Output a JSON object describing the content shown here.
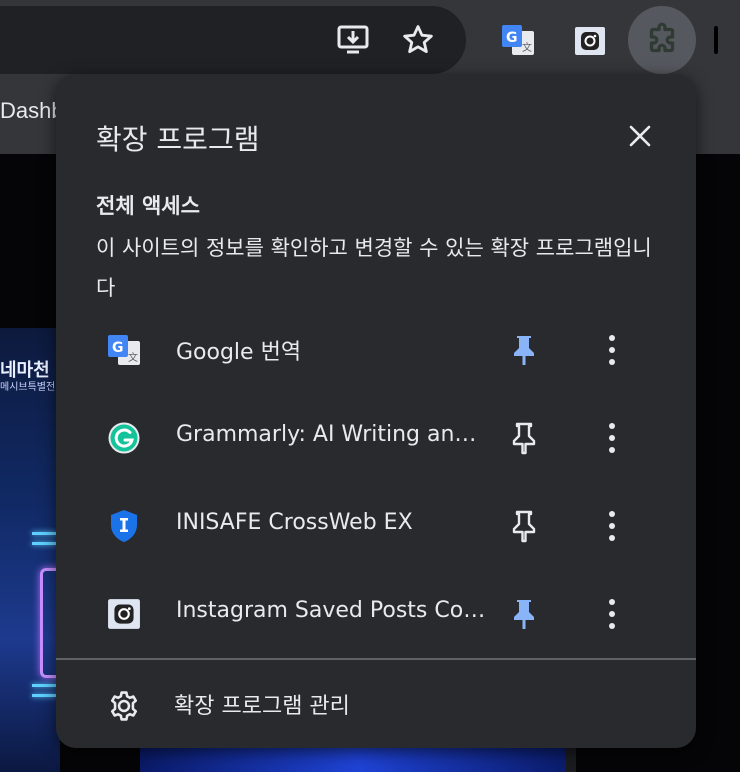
{
  "browser": {
    "tab_title": "Dashb",
    "toolbar_icons": [
      "install-app-icon",
      "bookmark-star-icon",
      "google-translate-icon",
      "instagram-saver-icon",
      "extensions-puzzle-icon"
    ]
  },
  "background_page": {
    "poster_title": "네마천",
    "poster_subtitle": "메시브특별전"
  },
  "popup": {
    "title": "확장 프로그램",
    "close_icon": "close-icon",
    "section": {
      "heading": "전체 액세스",
      "description": "이 사이트의 정보를 확인하고 변경할 수 있는 확장 프로그램입니다"
    },
    "extensions": [
      {
        "name": "Google 번역",
        "icon": "google-translate-icon",
        "pinned": true
      },
      {
        "name": "Grammarly: AI Writing and Grammar Checker App",
        "icon": "grammarly-icon",
        "pinned": false
      },
      {
        "name": "INISAFE CrossWeb EX",
        "icon": "inisafe-shield-icon",
        "pinned": false
      },
      {
        "name": "Instagram Saved Posts Collector",
        "icon": "instagram-saver-icon",
        "pinned": true
      }
    ],
    "manage_label": "확장 프로그램 관리"
  },
  "colors": {
    "popup_bg": "#292a2d",
    "text": "#e8eaed",
    "pinned_accent": "#8ab4f8",
    "toolbar_bg": "#35363a"
  }
}
